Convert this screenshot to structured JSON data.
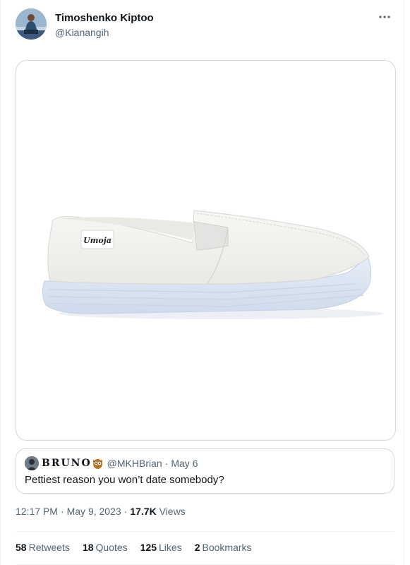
{
  "tweet": {
    "author": {
      "display_name": "Timoshenko Kiptoo",
      "handle": "@Kianangih"
    },
    "more_icon": "more-horizontal-icon",
    "media": {
      "brand_label": "Umoja",
      "colors": {
        "shoe_canvas": "#f2f2f0",
        "shoe_sole": "#dbe5f2"
      }
    },
    "quoted_tweet": {
      "author_name": "BRUNO",
      "author_emoji": "owl-icon",
      "handle": "@MKHBrian",
      "separator": "·",
      "date": "May 6",
      "text": "Pettiest reason you won’t date somebody?"
    },
    "meta": {
      "time": "12:17 PM",
      "separator": "·",
      "date": "May 9, 2023",
      "views_count": "17.7K",
      "views_label": "Views"
    },
    "stats": [
      {
        "count": "58",
        "label": "Retweets"
      },
      {
        "count": "18",
        "label": "Quotes"
      },
      {
        "count": "125",
        "label": "Likes"
      },
      {
        "count": "2",
        "label": "Bookmarks"
      }
    ]
  },
  "colors": {
    "text_primary": "#0f1419",
    "text_secondary": "#536471",
    "border": "#cfd9de"
  }
}
